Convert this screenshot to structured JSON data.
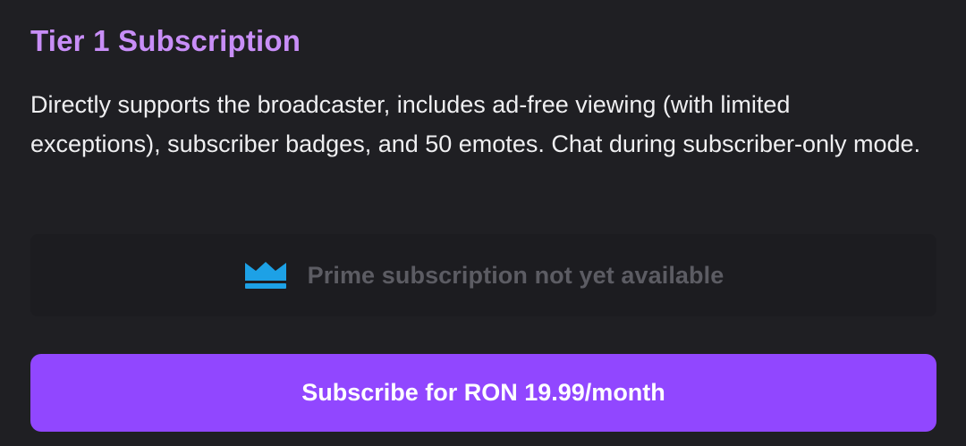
{
  "tier": {
    "title": "Tier 1 Subscription",
    "description": "Directly supports the broadcaster, includes ad-free viewing (with limited exceptions), subscriber badges, and 50 emotes. Chat during subscriber-only mode."
  },
  "prime": {
    "icon": "crown-icon",
    "message": "Prime subscription not yet available"
  },
  "subscribe": {
    "label": "Subscribe for RON 19.99/month"
  },
  "colors": {
    "background": "#1f1f23",
    "title_accent": "#c88ef7",
    "prime_blue": "#1da1e6",
    "prime_text": "#5c5c63",
    "button": "#9147ff"
  }
}
